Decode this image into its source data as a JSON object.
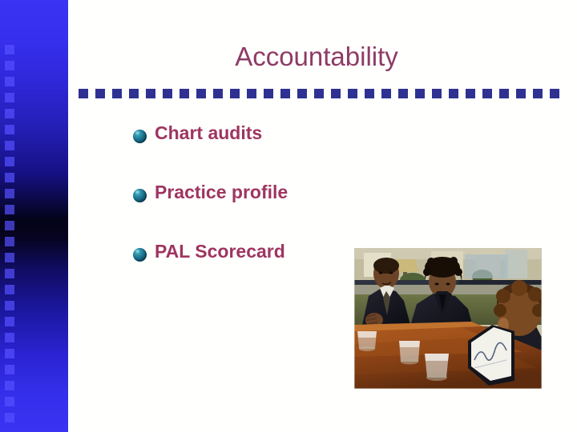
{
  "slide": {
    "title": "Accountability",
    "title_color": "#8e3b66",
    "background_color": "#fffffd"
  },
  "sidebar": {
    "name": "decorative-gradient-bar",
    "top_color": "#3a33f2",
    "mid_color": "#040318",
    "bottom_color": "#3a33f2",
    "square_color": "#5650ff",
    "square_count": 24
  },
  "divider": {
    "name": "dashed-rule",
    "dash_color": "#2f3192",
    "dash_count": 29
  },
  "bullets": {
    "marker_color": "#12627f",
    "text_color": "#9e3560",
    "items": [
      {
        "label": "Chart audits"
      },
      {
        "label": "Practice profile"
      },
      {
        "label": "PAL Scorecard"
      }
    ]
  },
  "photo": {
    "name": "business-meeting-photo",
    "description": "Three business people in dark suits seated around a polished wooden conference table with water glasses and an open laptop",
    "alt": "Business meeting around a conference table"
  }
}
